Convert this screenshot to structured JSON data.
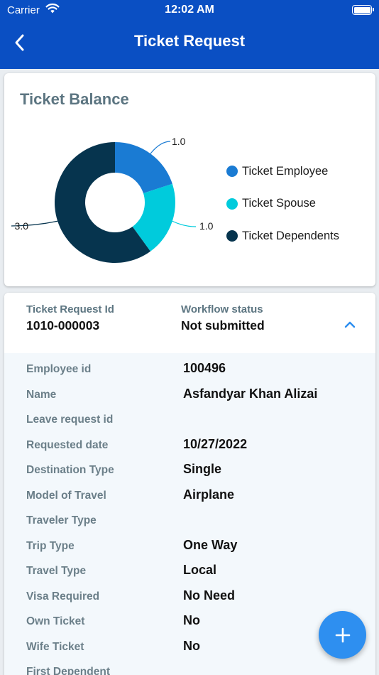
{
  "status_bar": {
    "carrier": "Carrier",
    "time": "12:02 AM"
  },
  "nav": {
    "title": "Ticket Request"
  },
  "ticket_balance": {
    "title": "Ticket Balance",
    "chart_data": {
      "type": "pie",
      "categories": [
        "Ticket Employee",
        "Ticket Spouse",
        "Ticket Dependents"
      ],
      "values": [
        1.0,
        1.0,
        3.0
      ],
      "value_labels": [
        "1.0",
        "1.0",
        "3.0"
      ],
      "colors": [
        "#1a7bd3",
        "#00cbdc",
        "#06344e"
      ],
      "legend_position": "right",
      "donut": true
    }
  },
  "request": {
    "id_label": "Ticket Request Id",
    "id_value": "1010-000003",
    "status_label": "Workflow status",
    "status_value": "Not submitted",
    "expanded": true,
    "fields": [
      {
        "label": "Employee id",
        "value": "100496"
      },
      {
        "label": "Name",
        "value": "Asfandyar Khan Alizai"
      },
      {
        "label": "Leave request id",
        "value": ""
      },
      {
        "label": "Requested date",
        "value": "10/27/2022"
      },
      {
        "label": "Destination Type",
        "value": "Single"
      },
      {
        "label": "Model of Travel",
        "value": "Airplane"
      },
      {
        "label": "Traveler Type",
        "value": ""
      },
      {
        "label": "Trip Type",
        "value": "One Way"
      },
      {
        "label": "Travel Type",
        "value": "Local"
      },
      {
        "label": "Visa Required",
        "value": "No Need"
      },
      {
        "label": "Own Ticket",
        "value": "No"
      },
      {
        "label": "Wife Ticket",
        "value": "No"
      },
      {
        "label": "First Dependent",
        "value": ""
      }
    ]
  },
  "colors": {
    "primary": "#0a4fc3",
    "fab": "#2e8ff0",
    "label_gray": "#5c7581"
  },
  "icons": {
    "back": "chevron-left-icon",
    "collapse": "chevron-up-icon",
    "add": "plus-icon"
  }
}
